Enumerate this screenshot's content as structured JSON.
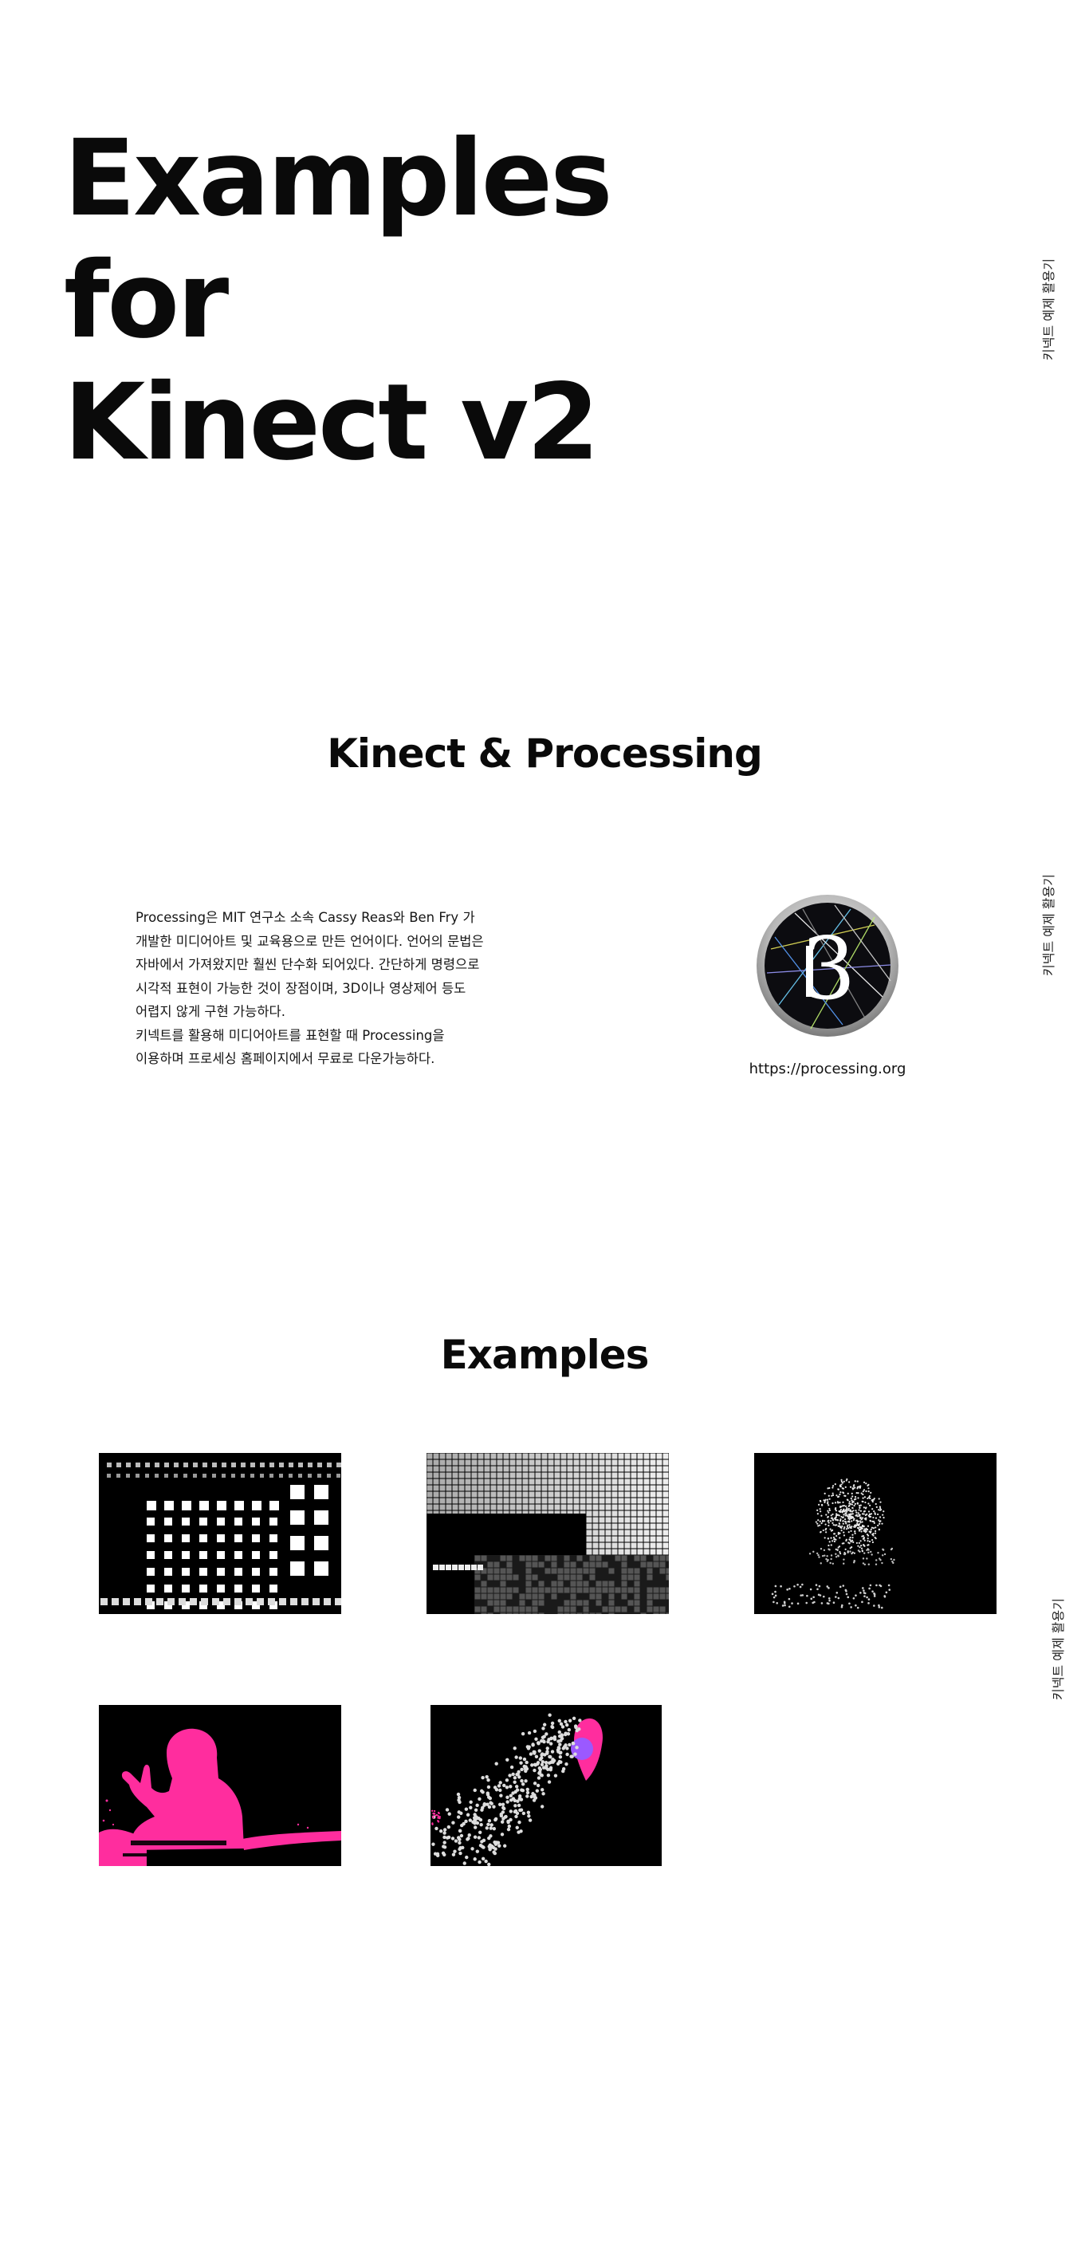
{
  "hero": {
    "line1": "Examples",
    "line2": "for",
    "line3": "Kinect v2"
  },
  "side_label": "키넥트 예제 활용기",
  "kinect_processing": {
    "title": "Kinect & Processing",
    "intro_lines": [
      "Processing은 MIT 연구소 소속 Cassy Reas와 Ben Fry 가",
      "개발한 미디어아트 및 교육용으로 만든 언어이다. 언어의 문법은",
      "자바에서 가져왔지만 훨씬 단수화 되어있다. 간단하게 명령으로",
      "시각적 표현이 가능한 것이 장점이며, 3D이나 영상제어 등도",
      "어렵지 않게 구현 가능하다.",
      "키넥트를 활용해 미디어아트를 표현할 때 Processing을",
      "이용하며 프로세싱 홈페이지에서 무료로 다운가능하다."
    ],
    "logo_icon": "processing-3-logo-icon",
    "logo_glyph": "P3",
    "url": "https://processing.org"
  },
  "examples": {
    "title": "Examples",
    "thumbnails": [
      "depth-grid-example",
      "depth-mesh-example",
      "point-cloud-example",
      "user-silhouette-example",
      "particle-flow-example"
    ]
  },
  "colors": {
    "background": "#ffffff",
    "text": "#111111",
    "thumb_bg": "#000000",
    "silhouette_pink": "#ff2d9e",
    "accent_purple": "#9b59ff"
  }
}
